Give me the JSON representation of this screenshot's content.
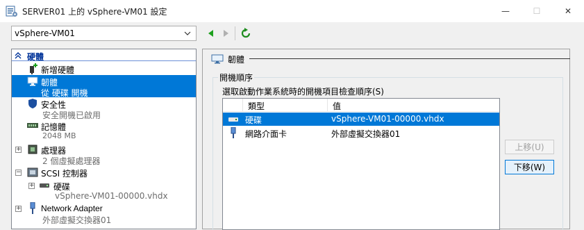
{
  "window": {
    "title": "SERVER01 上的 vSphere-VM01 設定",
    "minimize_glyph": "—",
    "maximize_glyph": "☐",
    "close_glyph": "✕"
  },
  "vm_selector": {
    "value": "vSphere-VM01",
    "chevron": "⌄"
  },
  "toolbar": {
    "back": "◀",
    "forward": "▶",
    "refresh": "↻"
  },
  "tree": {
    "section_header": "硬體",
    "items": [
      {
        "label": "新增硬體"
      },
      {
        "label": "韌體",
        "sub": "從 硬碟 開機"
      },
      {
        "label": "安全性",
        "sub": "安全開機已啟用"
      },
      {
        "label": "記憶體",
        "sub": "2048 MB"
      },
      {
        "label": "處理器",
        "sub": "2 個虛擬處理器",
        "expander": "+"
      },
      {
        "label": "SCSI 控制器",
        "expander": "−"
      },
      {
        "label": "硬碟",
        "sub": "vSphere-VM01-00000.vhdx",
        "expander": "+"
      },
      {
        "label": "Network Adapter",
        "sub": "外部虛擬交換器01",
        "expander": "+"
      }
    ]
  },
  "panel": {
    "title": "韌體",
    "group_label": "開機順序",
    "description": "選取啟動作業系統時的開機項目檢查順序(S)",
    "columns": [
      "類型",
      "值"
    ],
    "rows": [
      {
        "type": "硬碟",
        "value": "vSphere-VM01-00000.vhdx",
        "selected": true
      },
      {
        "type": "網路介面卡",
        "value": "外部虛擬交換器01",
        "selected": false
      }
    ],
    "move_up_label": "上移(U)",
    "move_down_label": "下移(W)"
  },
  "colors": {
    "selection": "#0078d7",
    "nav_green": "#1ea01e",
    "refresh_green": "#1e8c1e"
  }
}
